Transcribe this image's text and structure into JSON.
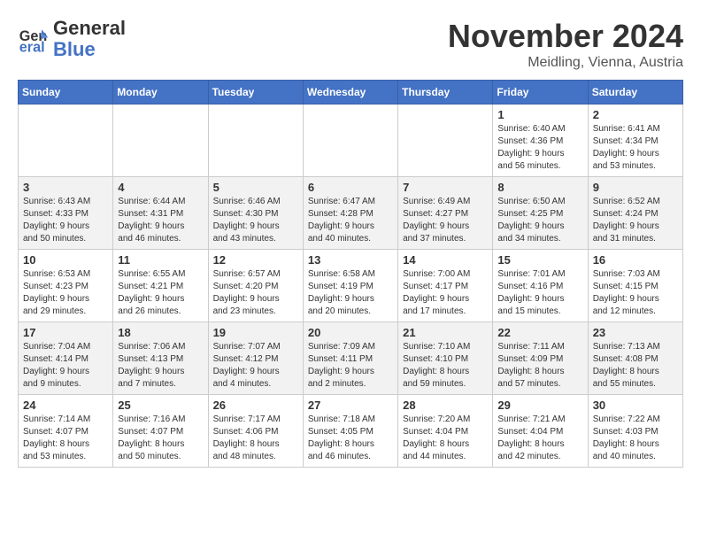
{
  "header": {
    "logo_line1": "General",
    "logo_line2": "Blue",
    "month_title": "November 2024",
    "location": "Meidling, Vienna, Austria"
  },
  "weekdays": [
    "Sunday",
    "Monday",
    "Tuesday",
    "Wednesday",
    "Thursday",
    "Friday",
    "Saturday"
  ],
  "weeks": [
    [
      {
        "day": "",
        "info": ""
      },
      {
        "day": "",
        "info": ""
      },
      {
        "day": "",
        "info": ""
      },
      {
        "day": "",
        "info": ""
      },
      {
        "day": "",
        "info": ""
      },
      {
        "day": "1",
        "info": "Sunrise: 6:40 AM\nSunset: 4:36 PM\nDaylight: 9 hours\nand 56 minutes."
      },
      {
        "day": "2",
        "info": "Sunrise: 6:41 AM\nSunset: 4:34 PM\nDaylight: 9 hours\nand 53 minutes."
      }
    ],
    [
      {
        "day": "3",
        "info": "Sunrise: 6:43 AM\nSunset: 4:33 PM\nDaylight: 9 hours\nand 50 minutes."
      },
      {
        "day": "4",
        "info": "Sunrise: 6:44 AM\nSunset: 4:31 PM\nDaylight: 9 hours\nand 46 minutes."
      },
      {
        "day": "5",
        "info": "Sunrise: 6:46 AM\nSunset: 4:30 PM\nDaylight: 9 hours\nand 43 minutes."
      },
      {
        "day": "6",
        "info": "Sunrise: 6:47 AM\nSunset: 4:28 PM\nDaylight: 9 hours\nand 40 minutes."
      },
      {
        "day": "7",
        "info": "Sunrise: 6:49 AM\nSunset: 4:27 PM\nDaylight: 9 hours\nand 37 minutes."
      },
      {
        "day": "8",
        "info": "Sunrise: 6:50 AM\nSunset: 4:25 PM\nDaylight: 9 hours\nand 34 minutes."
      },
      {
        "day": "9",
        "info": "Sunrise: 6:52 AM\nSunset: 4:24 PM\nDaylight: 9 hours\nand 31 minutes."
      }
    ],
    [
      {
        "day": "10",
        "info": "Sunrise: 6:53 AM\nSunset: 4:23 PM\nDaylight: 9 hours\nand 29 minutes."
      },
      {
        "day": "11",
        "info": "Sunrise: 6:55 AM\nSunset: 4:21 PM\nDaylight: 9 hours\nand 26 minutes."
      },
      {
        "day": "12",
        "info": "Sunrise: 6:57 AM\nSunset: 4:20 PM\nDaylight: 9 hours\nand 23 minutes."
      },
      {
        "day": "13",
        "info": "Sunrise: 6:58 AM\nSunset: 4:19 PM\nDaylight: 9 hours\nand 20 minutes."
      },
      {
        "day": "14",
        "info": "Sunrise: 7:00 AM\nSunset: 4:17 PM\nDaylight: 9 hours\nand 17 minutes."
      },
      {
        "day": "15",
        "info": "Sunrise: 7:01 AM\nSunset: 4:16 PM\nDaylight: 9 hours\nand 15 minutes."
      },
      {
        "day": "16",
        "info": "Sunrise: 7:03 AM\nSunset: 4:15 PM\nDaylight: 9 hours\nand 12 minutes."
      }
    ],
    [
      {
        "day": "17",
        "info": "Sunrise: 7:04 AM\nSunset: 4:14 PM\nDaylight: 9 hours\nand 9 minutes."
      },
      {
        "day": "18",
        "info": "Sunrise: 7:06 AM\nSunset: 4:13 PM\nDaylight: 9 hours\nand 7 minutes."
      },
      {
        "day": "19",
        "info": "Sunrise: 7:07 AM\nSunset: 4:12 PM\nDaylight: 9 hours\nand 4 minutes."
      },
      {
        "day": "20",
        "info": "Sunrise: 7:09 AM\nSunset: 4:11 PM\nDaylight: 9 hours\nand 2 minutes."
      },
      {
        "day": "21",
        "info": "Sunrise: 7:10 AM\nSunset: 4:10 PM\nDaylight: 8 hours\nand 59 minutes."
      },
      {
        "day": "22",
        "info": "Sunrise: 7:11 AM\nSunset: 4:09 PM\nDaylight: 8 hours\nand 57 minutes."
      },
      {
        "day": "23",
        "info": "Sunrise: 7:13 AM\nSunset: 4:08 PM\nDaylight: 8 hours\nand 55 minutes."
      }
    ],
    [
      {
        "day": "24",
        "info": "Sunrise: 7:14 AM\nSunset: 4:07 PM\nDaylight: 8 hours\nand 53 minutes."
      },
      {
        "day": "25",
        "info": "Sunrise: 7:16 AM\nSunset: 4:07 PM\nDaylight: 8 hours\nand 50 minutes."
      },
      {
        "day": "26",
        "info": "Sunrise: 7:17 AM\nSunset: 4:06 PM\nDaylight: 8 hours\nand 48 minutes."
      },
      {
        "day": "27",
        "info": "Sunrise: 7:18 AM\nSunset: 4:05 PM\nDaylight: 8 hours\nand 46 minutes."
      },
      {
        "day": "28",
        "info": "Sunrise: 7:20 AM\nSunset: 4:04 PM\nDaylight: 8 hours\nand 44 minutes."
      },
      {
        "day": "29",
        "info": "Sunrise: 7:21 AM\nSunset: 4:04 PM\nDaylight: 8 hours\nand 42 minutes."
      },
      {
        "day": "30",
        "info": "Sunrise: 7:22 AM\nSunset: 4:03 PM\nDaylight: 8 hours\nand 40 minutes."
      }
    ]
  ]
}
